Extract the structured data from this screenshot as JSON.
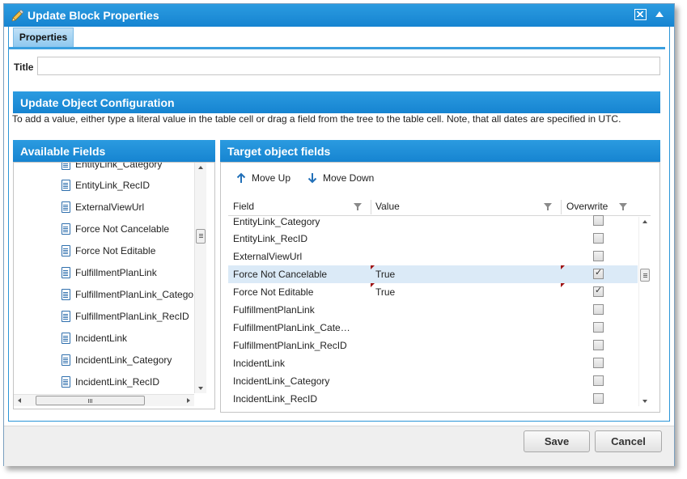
{
  "dialog": {
    "title": "Update Block Properties",
    "icons": {
      "edit": "pencil-icon",
      "maximize": "maximize-icon",
      "collapse": "collapse-up-icon"
    }
  },
  "tabs": [
    {
      "label": "Properties",
      "active": true
    }
  ],
  "title_field": {
    "label": "Title",
    "value": ""
  },
  "section": {
    "heading": "Update Object Configuration",
    "description": "To add a value, either type a literal value in the table cell or drag a field from the tree to the table cell. Note, that all dates are specified in UTC."
  },
  "available_fields": {
    "heading": "Available Fields",
    "items": [
      "EntityLink_Category",
      "EntityLink_RecID",
      "ExternalViewUrl",
      "Force Not Cancelable",
      "Force Not Editable",
      "FulfillmentPlanLink",
      "FulfillmentPlanLink_Category",
      "FulfillmentPlanLink_RecID",
      "IncidentLink",
      "IncidentLink_Category",
      "IncidentLink_RecID"
    ]
  },
  "target_fields": {
    "heading": "Target object fields",
    "toolbar": {
      "move_up": "Move Up",
      "move_down": "Move Down"
    },
    "columns": {
      "field": "Field",
      "value": "Value",
      "overwrite": "Overwrite"
    },
    "rows": [
      {
        "field": "EntityLink_Category",
        "value": "",
        "overwrite": false,
        "selected": false
      },
      {
        "field": "EntityLink_RecID",
        "value": "",
        "overwrite": false,
        "selected": false
      },
      {
        "field": "ExternalViewUrl",
        "value": "",
        "overwrite": false,
        "selected": false
      },
      {
        "field": "Force Not Cancelable",
        "value": "True",
        "overwrite": true,
        "selected": true
      },
      {
        "field": "Force Not Editable",
        "value": "True",
        "overwrite": true,
        "selected": false
      },
      {
        "field": "FulfillmentPlanLink",
        "value": "",
        "overwrite": false,
        "selected": false
      },
      {
        "field": "FulfillmentPlanLink_Cate…",
        "value": "",
        "overwrite": false,
        "selected": false
      },
      {
        "field": "FulfillmentPlanLink_RecID",
        "value": "",
        "overwrite": false,
        "selected": false
      },
      {
        "field": "IncidentLink",
        "value": "",
        "overwrite": false,
        "selected": false
      },
      {
        "field": "IncidentLink_Category",
        "value": "",
        "overwrite": false,
        "selected": false
      },
      {
        "field": "IncidentLink_RecID",
        "value": "",
        "overwrite": false,
        "selected": false
      }
    ]
  },
  "footer": {
    "save": "Save",
    "cancel": "Cancel"
  },
  "colors": {
    "header_blue": "#1a8bd6",
    "selected_row": "#dbeaf7",
    "dirty_marker": "#a01313"
  }
}
